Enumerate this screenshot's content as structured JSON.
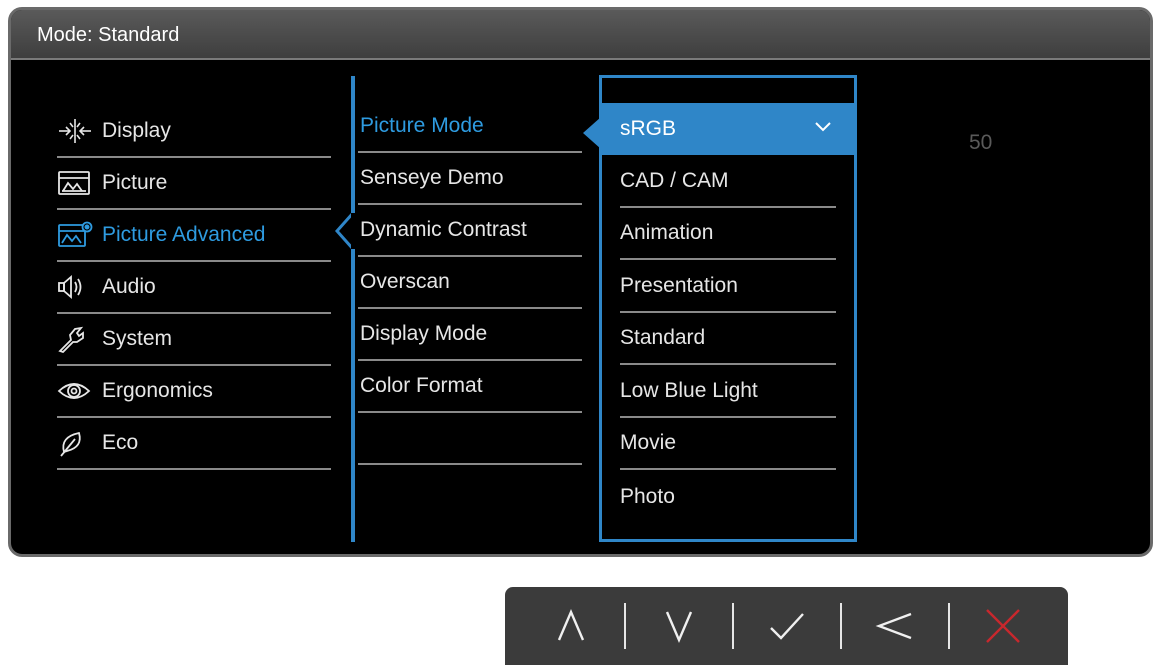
{
  "header": {
    "title": "Mode: Standard"
  },
  "main_menu": {
    "items": [
      {
        "label": "Display",
        "icon": "display-icon"
      },
      {
        "label": "Picture",
        "icon": "picture-icon"
      },
      {
        "label": "Picture Advanced",
        "icon": "picture-advanced-icon",
        "active": true
      },
      {
        "label": "Audio",
        "icon": "audio-icon"
      },
      {
        "label": "System",
        "icon": "system-icon"
      },
      {
        "label": "Ergonomics",
        "icon": "ergonomics-icon"
      },
      {
        "label": "Eco",
        "icon": "eco-icon"
      }
    ]
  },
  "sub_menu": {
    "items": [
      {
        "label": "Picture Mode",
        "active": true
      },
      {
        "label": "Senseye Demo"
      },
      {
        "label": "Dynamic Contrast"
      },
      {
        "label": "Overscan"
      },
      {
        "label": "Display Mode"
      },
      {
        "label": "Color Format"
      },
      {
        "label": ""
      }
    ]
  },
  "options": {
    "items": [
      {
        "label": "sRGB",
        "selected": true
      },
      {
        "label": "CAD / CAM"
      },
      {
        "label": "Animation"
      },
      {
        "label": "Presentation"
      },
      {
        "label": "Standard"
      },
      {
        "label": "Low Blue Light"
      },
      {
        "label": "Movie"
      },
      {
        "label": "Photo"
      }
    ]
  },
  "value_display": "50",
  "keys": [
    {
      "name": "up",
      "icon": "chevron-up-icon"
    },
    {
      "name": "down",
      "icon": "chevron-down-icon"
    },
    {
      "name": "ok",
      "icon": "check-icon"
    },
    {
      "name": "back",
      "icon": "chevron-left-icon"
    },
    {
      "name": "exit",
      "icon": "close-icon"
    }
  ],
  "colors": {
    "accent": "#2f86c8",
    "active_text": "#2e9be0",
    "exit_key": "#c8282d",
    "panel_bg": "#000000",
    "keybar_bg": "#3b3b3b"
  }
}
